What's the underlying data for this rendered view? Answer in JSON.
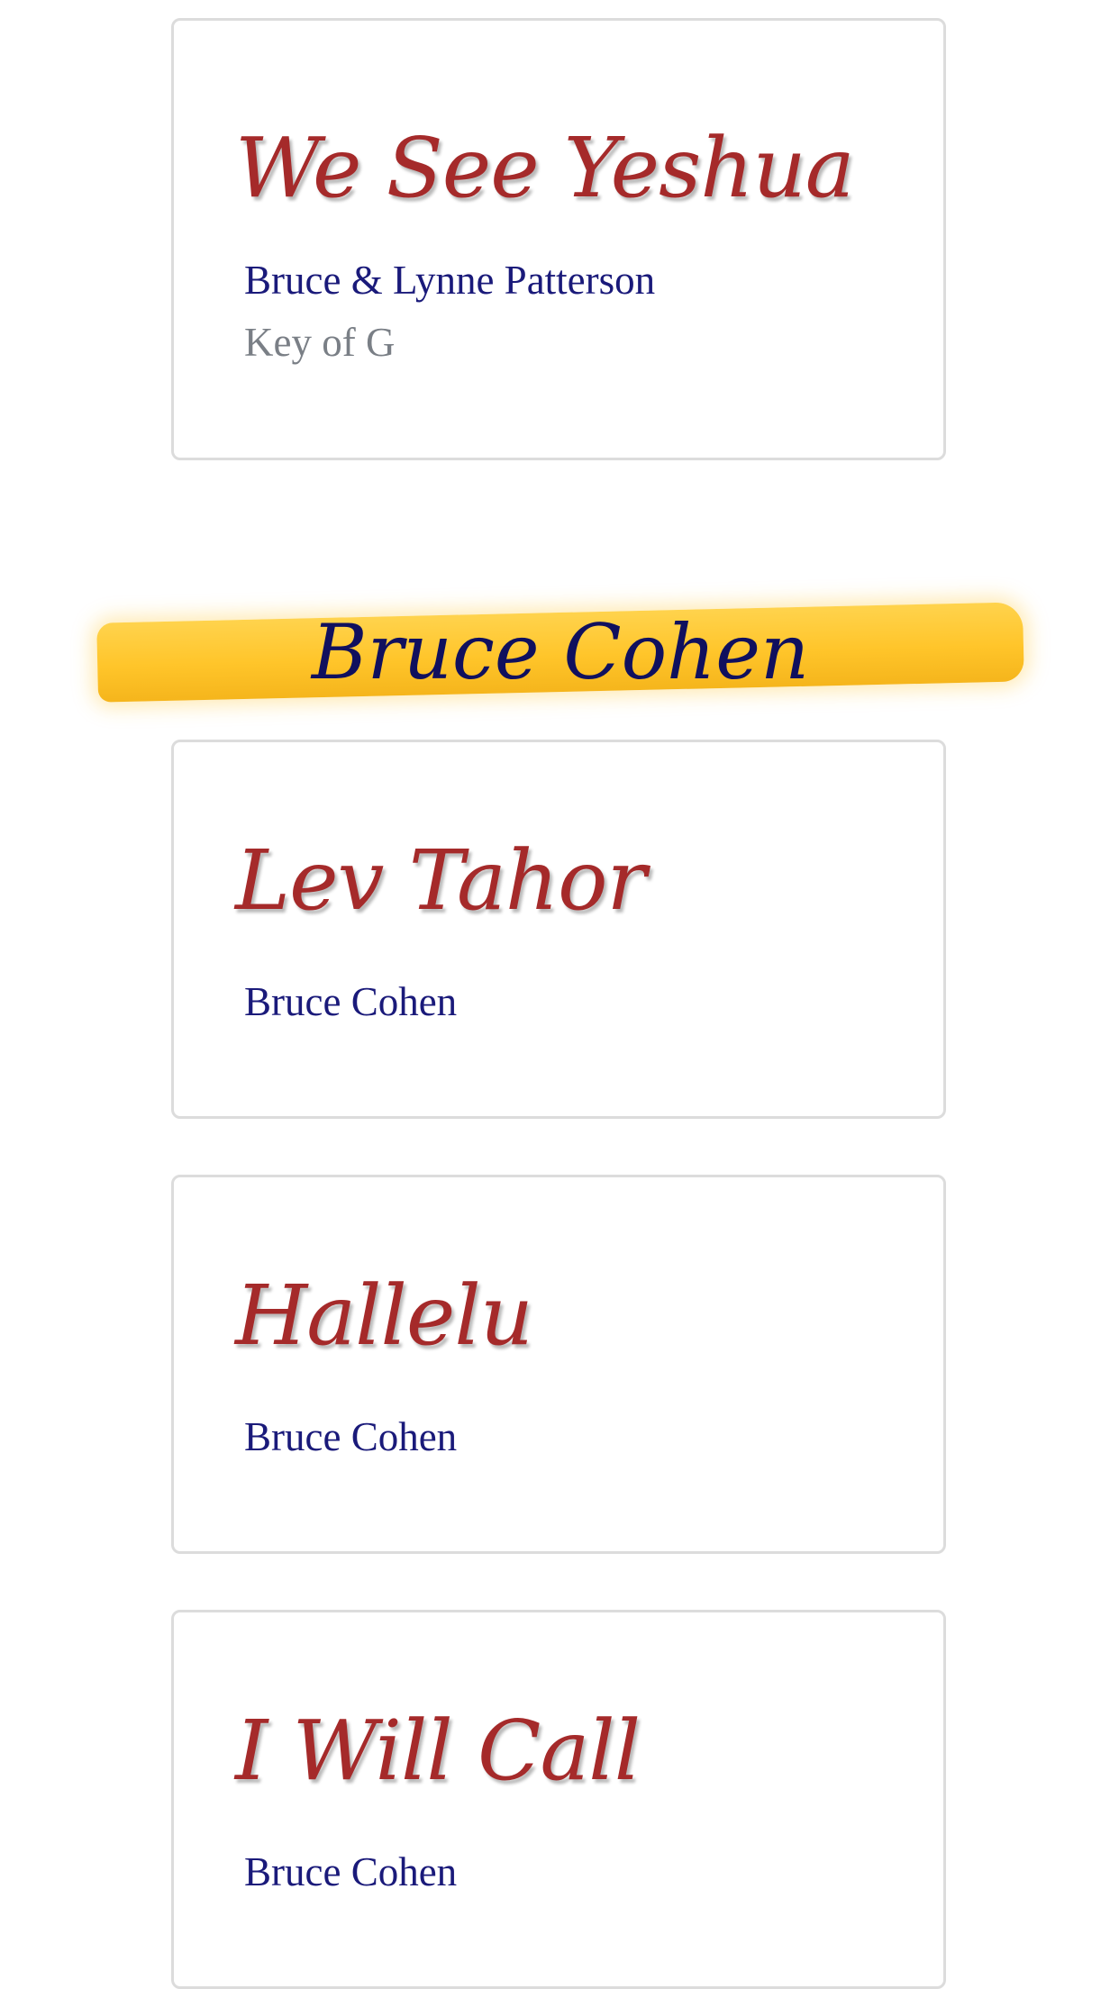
{
  "songs_top": [
    {
      "title": "We See Yeshua",
      "artist": "Bruce & Lynne Patterson",
      "key": "Key of G"
    }
  ],
  "section": {
    "title": "Bruce Cohen"
  },
  "songs": [
    {
      "title": "Lev Tahor",
      "artist": "Bruce Cohen"
    },
    {
      "title": "Hallelu",
      "artist": "Bruce Cohen"
    },
    {
      "title": "I Will Call",
      "artist": "Bruce Cohen"
    }
  ],
  "colors": {
    "title": "#a52a2a",
    "artist": "#1a1a7a",
    "key": "#7a7f86",
    "highlight": "#ffc52a",
    "card_border": "#dcdcdc"
  }
}
